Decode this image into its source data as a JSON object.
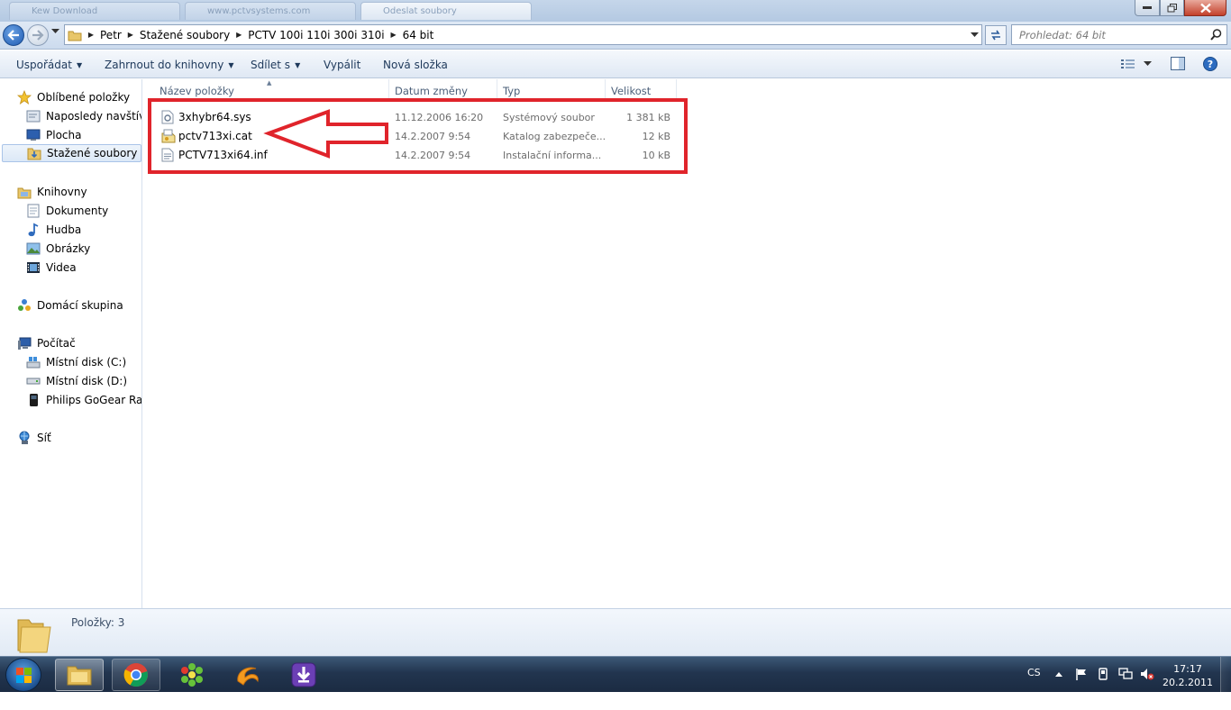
{
  "titlebar": {
    "tabs": [
      "Kew Download",
      "www.pctvsystems.com",
      "Odeslat soubory"
    ]
  },
  "address": {
    "crumbs": [
      "Petr",
      "Stažené soubory",
      "PCTV 100i 110i 300i 310i",
      "64 bit"
    ]
  },
  "search": {
    "placeholder": "Prohledat: 64 bit"
  },
  "commands": {
    "organize": "Uspořádat",
    "include_library": "Zahrnout do knihovny",
    "share": "Sdílet s",
    "burn": "Vypálit",
    "new_folder": "Nová složka"
  },
  "navpane": {
    "favorites": "Oblíbené položky",
    "recent": "Naposledy navštíver",
    "desktop": "Plocha",
    "downloads": "Stažené soubory",
    "libraries": "Knihovny",
    "documents": "Dokumenty",
    "music": "Hudba",
    "pictures": "Obrázky",
    "videos": "Videa",
    "homegroup": "Domácí skupina",
    "computer": "Počítač",
    "disk_c": "Místní disk (C:)",
    "disk_d": "Místní disk (D:)",
    "philips": "Philips GoGear Raga",
    "network": "Síť"
  },
  "columns": {
    "name": "Název položky",
    "date": "Datum změny",
    "type": "Typ",
    "size": "Velikost"
  },
  "files": [
    {
      "name": "3xhybr64.sys",
      "date": "11.12.2006 16:20",
      "type": "Systémový soubor",
      "size": "1 381 kB",
      "icon": "sys-file-icon"
    },
    {
      "name": "pctv713xi.cat",
      "date": "14.2.2007 9:54",
      "type": "Katalog zabezpeče...",
      "size": "12 kB",
      "icon": "catalog-file-icon"
    },
    {
      "name": "PCTV713xi64.inf",
      "date": "14.2.2007 9:54",
      "type": "Instalační informa...",
      "size": "10 kB",
      "icon": "inf-file-icon"
    }
  ],
  "details": {
    "count": "Položky: 3"
  },
  "taskbar": {
    "lang": "CS",
    "time": "17:17",
    "date": "20.2.2011"
  },
  "colors": {
    "highlight_box": "#e0242b",
    "taskbar": "#22354f",
    "link_text": "#1e395b"
  }
}
